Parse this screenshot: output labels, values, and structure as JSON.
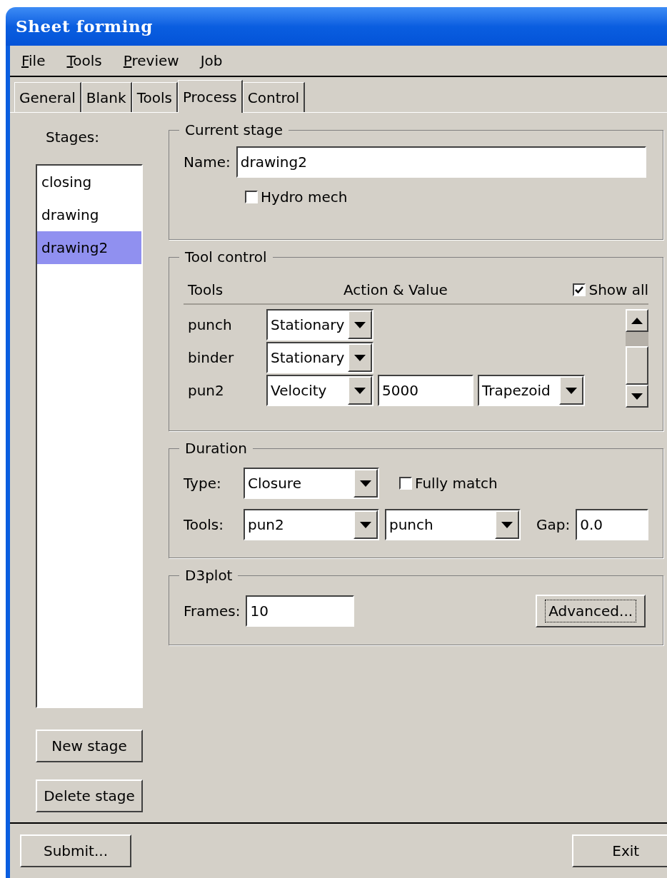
{
  "window": {
    "title": "Sheet forming"
  },
  "menu": [
    {
      "mnemonic": "F",
      "rest": "ile"
    },
    {
      "mnemonic": "T",
      "rest": "ools"
    },
    {
      "mnemonic": "P",
      "rest": "review"
    },
    {
      "mnemonic": "J",
      "rest": "ob"
    }
  ],
  "tabs": [
    {
      "label": "General",
      "selected": false
    },
    {
      "label": "Blank",
      "selected": false
    },
    {
      "label": "Tools",
      "selected": false
    },
    {
      "label": "Process",
      "selected": true
    },
    {
      "label": "Control",
      "selected": false
    }
  ],
  "stages": {
    "label": "Stages:",
    "items": [
      {
        "label": "closing",
        "selected": false
      },
      {
        "label": "drawing",
        "selected": false
      },
      {
        "label": "drawing2",
        "selected": true
      }
    ],
    "buttons": [
      "New stage",
      "Delete stage"
    ]
  },
  "current_stage": {
    "title": "Current stage",
    "name_label": "Name:",
    "name_value": "drawing2",
    "hydro_mech": {
      "label": "Hydro mech",
      "checked": false
    }
  },
  "tool_control": {
    "title": "Tool control",
    "headers": [
      "Tools",
      "Action & Value"
    ],
    "show_all": {
      "label": "Show all",
      "checked": true
    },
    "rows": [
      {
        "tool": "punch",
        "action": "Stationary"
      },
      {
        "tool": "binder",
        "action": "Stationary"
      },
      {
        "tool": "pun2",
        "action": "Velocity",
        "value": "5000",
        "profile": "Trapezoid"
      }
    ]
  },
  "duration": {
    "title": "Duration",
    "type_label": "Type:",
    "type_value": "Closure",
    "fully_match": {
      "label": "Fully match",
      "checked": false
    },
    "tools_label": "Tools:",
    "tool_1": "pun2",
    "tool_2": "punch",
    "gap_label": "Gap:",
    "gap_value": "0.0"
  },
  "d3plot": {
    "title": "D3plot",
    "frames_label": "Frames:",
    "frames_value": "10",
    "advanced_button": {
      "label": "Advanced...",
      "focused": true
    }
  },
  "footer_buttons": [
    "Submit...",
    "Exit"
  ]
}
